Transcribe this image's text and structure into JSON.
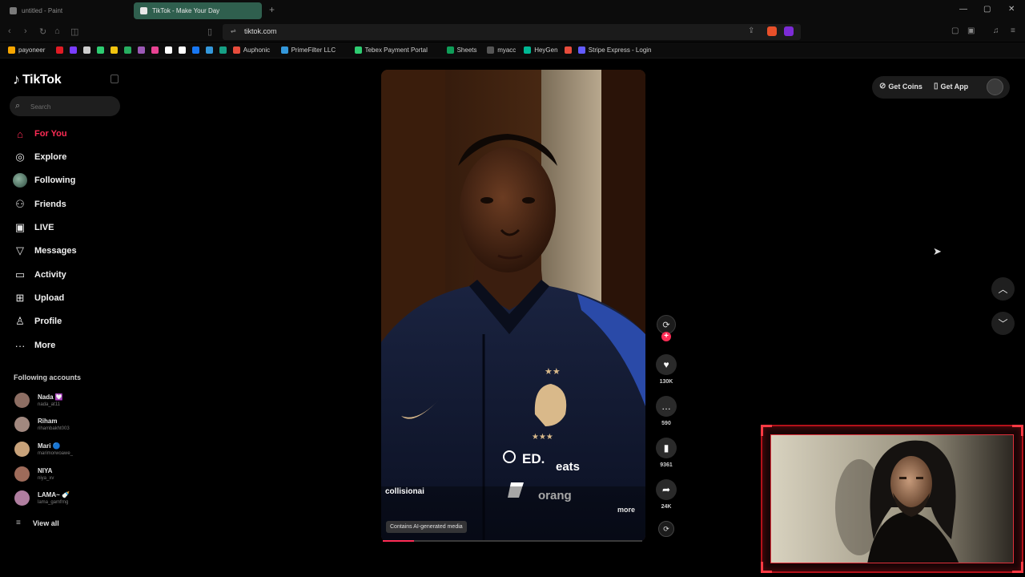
{
  "browser": {
    "tabs": [
      {
        "title": "untitled - Paint"
      },
      {
        "title": "TikTok - Make Your Day"
      }
    ],
    "new_tab": "+",
    "url": "tiktok.com",
    "bookmarks": [
      {
        "label": "payoneer",
        "color": "#f7a600"
      },
      {
        "label": "",
        "color": "#e01b24"
      },
      {
        "label": "",
        "color": "#7a3cff"
      },
      {
        "label": "",
        "color": "#cccccc"
      },
      {
        "label": "",
        "color": "#2ecc71"
      },
      {
        "label": "",
        "color": "#f1c40f"
      },
      {
        "label": "",
        "color": "#27ae60"
      },
      {
        "label": "",
        "color": "#9b59b6"
      },
      {
        "label": "",
        "color": "#e84393"
      },
      {
        "label": "",
        "color": "#ffffff"
      },
      {
        "label": "",
        "color": "#ffffff"
      },
      {
        "label": "",
        "color": "#1877f2"
      },
      {
        "label": "",
        "color": "#3498db"
      },
      {
        "label": "",
        "color": "#16a085"
      },
      {
        "label": "Auphonic",
        "color": "#e74c3c"
      },
      {
        "label": "PrimeFilter LLC",
        "color": "#3498db"
      },
      {
        "label": "Tebex Payment Portal",
        "color": "#2ecc71"
      },
      {
        "label": "Sheets",
        "color": "#0f9d58"
      },
      {
        "label": "myacc",
        "color": "#555555"
      },
      {
        "label": "HeyGen",
        "color": "#00b894"
      },
      {
        "label": "",
        "color": "#e74c3c"
      },
      {
        "label": "Stripe Express - Login",
        "color": "#635bff"
      }
    ]
  },
  "tiktok": {
    "logo": "TikTok",
    "search_placeholder": "Search",
    "nav": [
      {
        "label": "For You",
        "icon": "home-icon"
      },
      {
        "label": "Explore",
        "icon": "compass-icon"
      },
      {
        "label": "Following",
        "icon": "avatar-icon"
      },
      {
        "label": "Friends",
        "icon": "friends-icon"
      },
      {
        "label": "LIVE",
        "icon": "live-icon"
      },
      {
        "label": "Messages",
        "icon": "messages-icon"
      },
      {
        "label": "Activity",
        "icon": "activity-icon"
      },
      {
        "label": "Upload",
        "icon": "upload-icon"
      },
      {
        "label": "Profile",
        "icon": "profile-icon"
      },
      {
        "label": "More",
        "icon": "more-icon"
      }
    ],
    "following_accounts_title": "Following accounts",
    "accounts": [
      {
        "name": "Nada 💟",
        "handle": "nada_at11",
        "color": "#8d6e63"
      },
      {
        "name": "Riham",
        "handle": "rihambakht003",
        "color": "#a1887f"
      },
      {
        "name": "Mari 🔵",
        "handle": "marimorwoawe_",
        "color": "#c8a27a"
      },
      {
        "name": "NIYA",
        "handle": "niya_xv",
        "color": "#9e6b5a"
      },
      {
        "name": "LAMA~ 🍼",
        "handle": "lama_gamfrng",
        "color": "#b07ea0"
      }
    ],
    "view_all": "View all",
    "video": {
      "creator": "collisionai",
      "more": "more",
      "ai_label": "Contains AI-generated media",
      "progress": 0.12,
      "jersey_sponsor_1": "ED.",
      "jersey_sponsor_2": "eats",
      "jersey_sponsor_3": "orang"
    },
    "actions": {
      "likes": "130K",
      "comments": "590",
      "saves": "9361",
      "shares": "24K"
    },
    "top_right": {
      "get_coins": "Get Coins",
      "get_app": "Get App"
    }
  },
  "colors": {
    "accent": "#fe2c55",
    "tab_active": "#2f5f4e",
    "webcam_frame": "#b3121a"
  }
}
